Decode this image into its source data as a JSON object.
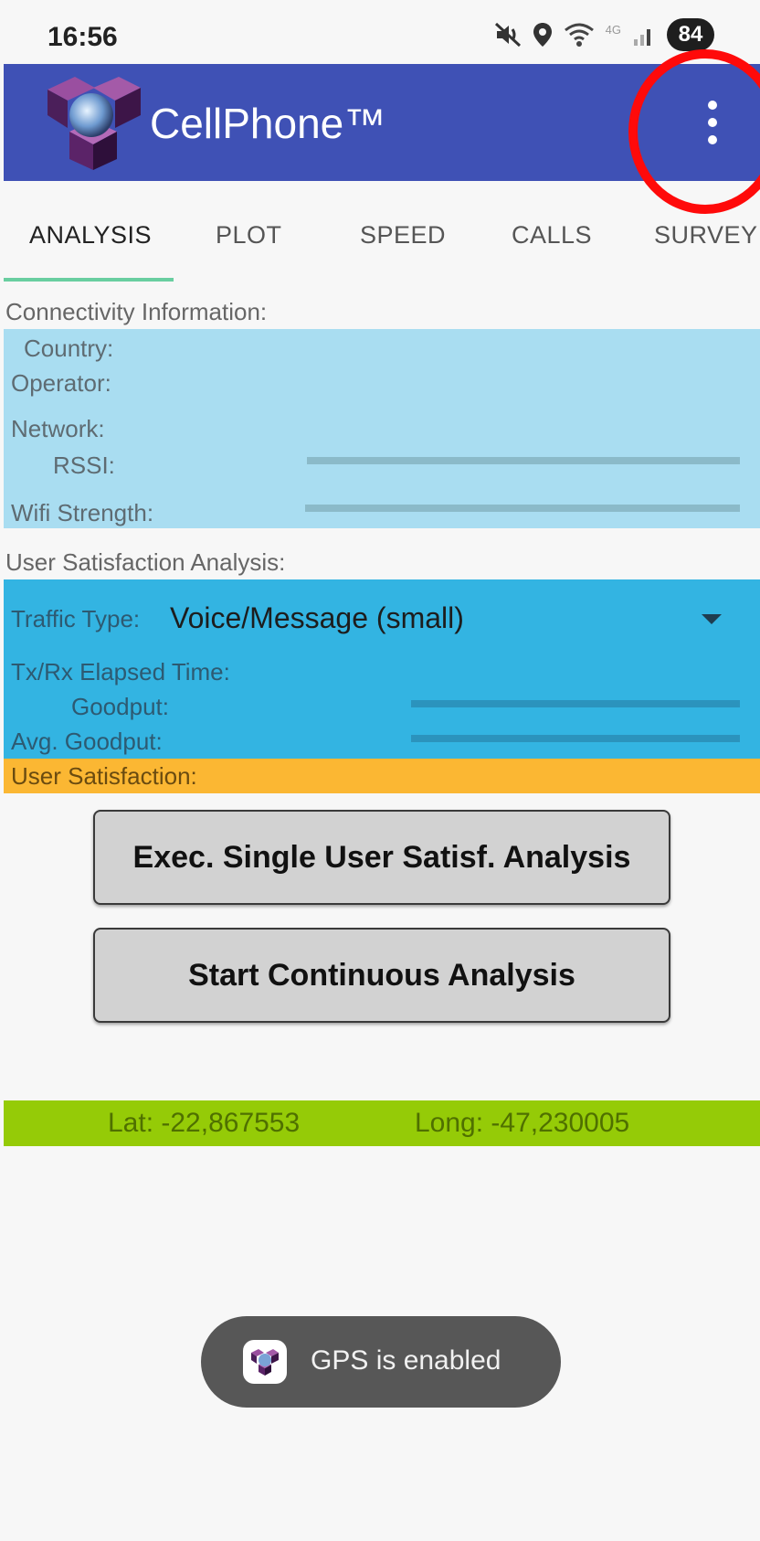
{
  "status_bar": {
    "time": "16:56",
    "network_type": "4G",
    "battery": "84",
    "icons": [
      "mute-icon",
      "location-pin-icon",
      "wifi-icon",
      "signal-icon",
      "battery-icon"
    ]
  },
  "app_bar": {
    "title": "CellPhone™",
    "color": "#3f51b5",
    "menu_icon": "overflow-menu-icon",
    "highlight_color": "#ff0a0a"
  },
  "tabs": [
    {
      "label": "ANALYSIS",
      "active": true
    },
    {
      "label": "PLOT",
      "active": false
    },
    {
      "label": "SPEED",
      "active": false
    },
    {
      "label": "CALLS",
      "active": false
    },
    {
      "label": "SURVEY",
      "active": false
    }
  ],
  "connectivity": {
    "section_label": "Connectivity Information:",
    "country_label": "Country:",
    "operator_label": "Operator:",
    "network_label": "Network:",
    "rssi_label": "RSSI:",
    "wifi_label": "Wifi Strength:",
    "rssi_level": 0,
    "wifi_level": 0,
    "panel_color": "#a9ddf1"
  },
  "user_satisfaction": {
    "section_label": "User Satisfaction Analysis:",
    "traffic_type_label": "Traffic Type:",
    "traffic_type_value": "Voice/Message (small)",
    "elapsed_label": "Tx/Rx Elapsed Time:",
    "goodput_label": "Goodput:",
    "avg_goodput_label": "Avg. Goodput:",
    "satisfaction_label": "User Satisfaction:",
    "goodput_level": 0,
    "avg_goodput_level": 0,
    "panel_color": "#33b4e2",
    "satisfaction_color": "#fbb733"
  },
  "buttons": {
    "single_analysis": "Exec. Single User Satisf. Analysis",
    "continuous_analysis": "Start Continuous Analysis"
  },
  "location": {
    "lat": "Lat: -22,867553",
    "long": "Long: -47,230005",
    "strip_color": "#95cb07"
  },
  "toast": {
    "text": "GPS is enabled",
    "icon": "app-logo-icon"
  }
}
